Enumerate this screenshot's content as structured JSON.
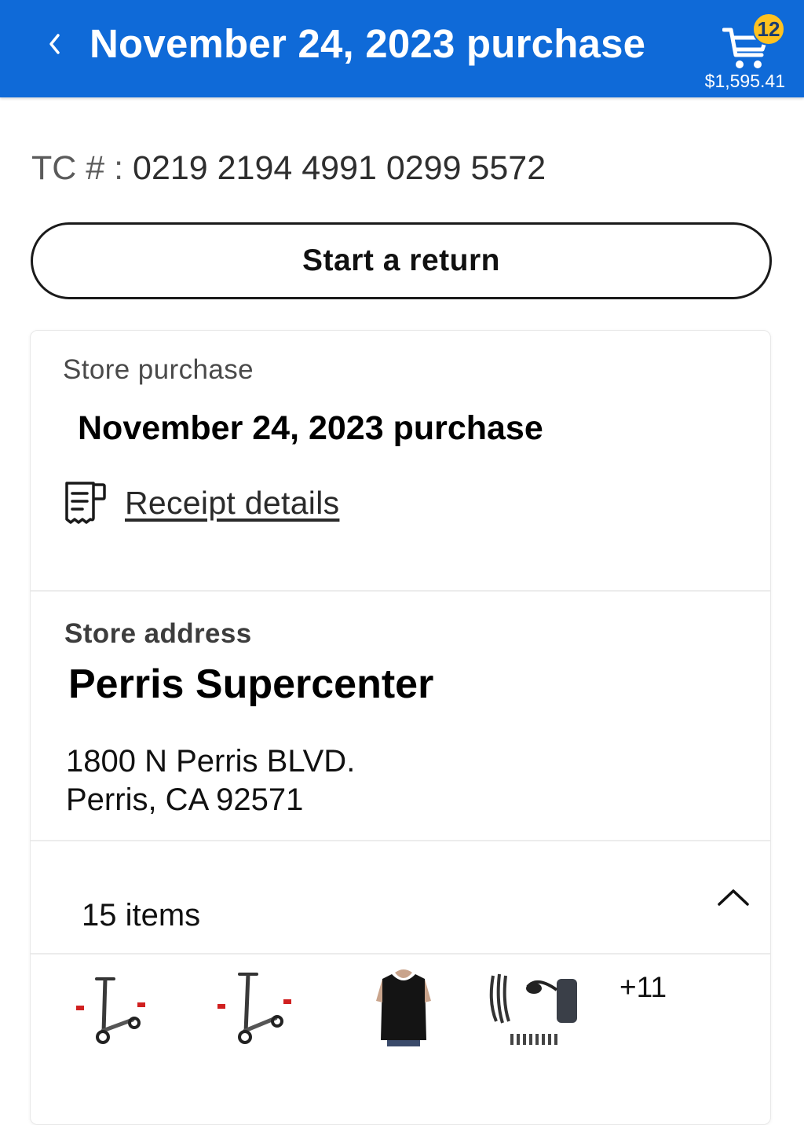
{
  "header": {
    "title": "November 24, 2023 purchase",
    "cart_count": "12",
    "cart_total": "$1,595.41",
    "icons": {
      "back": "chevron-left-icon",
      "cart": "cart-icon"
    },
    "colors": {
      "background": "#0f6ad8",
      "badge": "#ffc220"
    }
  },
  "transaction": {
    "label": "TC # :",
    "number": "0219 2194 4991 0299 5572"
  },
  "actions": {
    "start_return": "Start a return"
  },
  "purchase": {
    "type_label": "Store purchase",
    "title": "November 24, 2023 purchase",
    "receipt_link": "Receipt details",
    "receipt_icon": "receipt-icon"
  },
  "store": {
    "section_label": "Store address",
    "name": "Perris Supercenter",
    "address_line1": "1800 N Perris BLVD.",
    "address_line2": "Perris, CA 92571"
  },
  "items": {
    "count_label": "15 items",
    "more_label": "+11",
    "thumbnails": [
      "electric-scooter",
      "electric-scooter",
      "black-v-neck-t-shirt",
      "universal-power-adapter"
    ],
    "toggle_icon": "chevron-up-icon"
  }
}
